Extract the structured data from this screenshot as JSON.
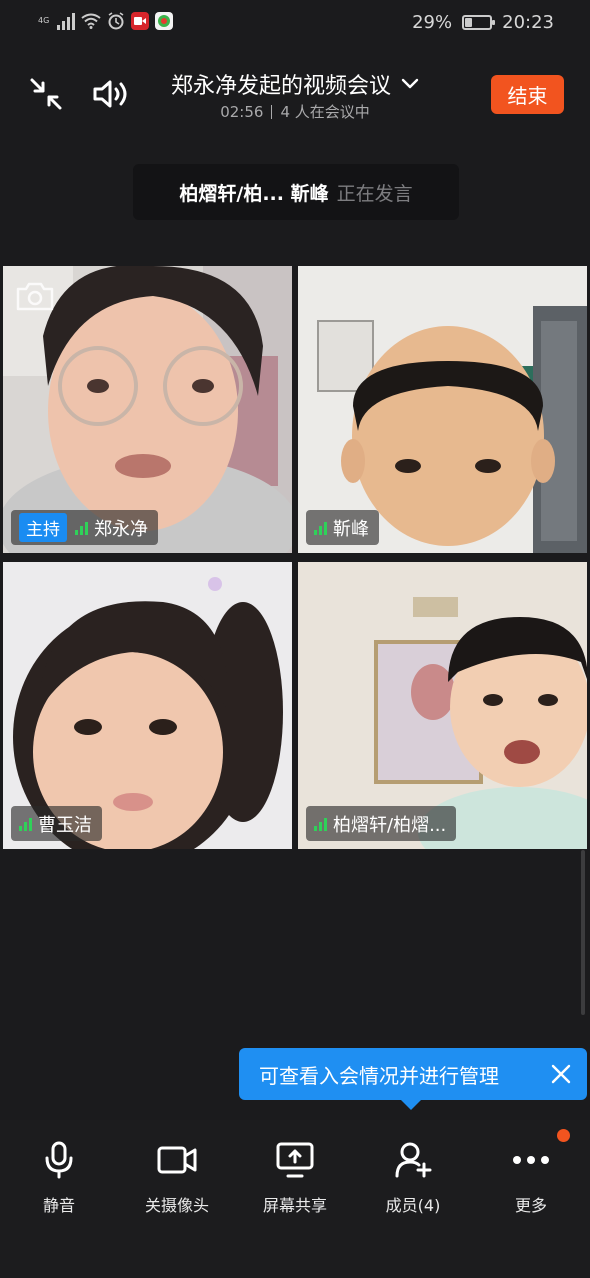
{
  "status_bar": {
    "network": "4G",
    "battery_percent": "29%",
    "battery_level": 0.29,
    "time": "20:23"
  },
  "header": {
    "title": "郑永净发起的视频会议",
    "duration": "02:56",
    "participants_text": "4 人在会议中",
    "end_label": "结束"
  },
  "speaking": {
    "names": "柏熠轩/柏... 靳峰",
    "status": "正在发言"
  },
  "tiles": [
    {
      "name": "郑永净",
      "host_label": "主持",
      "speaking": false
    },
    {
      "name": "靳峰",
      "speaking": true
    },
    {
      "name": "曹玉洁",
      "speaking": false
    },
    {
      "name": "柏熠轩/柏熠...",
      "speaking": true
    }
  ],
  "tooltip": {
    "text": "可查看入会情况并进行管理"
  },
  "toolbar": {
    "mute_label": "静音",
    "camera_label": "关摄像头",
    "share_label": "屏幕共享",
    "members_label": "成员(4)",
    "more_label": "更多"
  },
  "colors": {
    "end_button": "#f2541f",
    "speaking_border": "#22b04b",
    "host_badge": "#1a8cf2",
    "tooltip": "#1f8ff2",
    "audio_level": "#2fd159"
  },
  "icons": [
    "minimize-icon",
    "speaker-icon",
    "chevron-down-icon",
    "camera-switch-icon",
    "microphone-icon",
    "video-camera-icon",
    "screen-share-icon",
    "add-member-icon",
    "more-icon",
    "close-icon"
  ]
}
